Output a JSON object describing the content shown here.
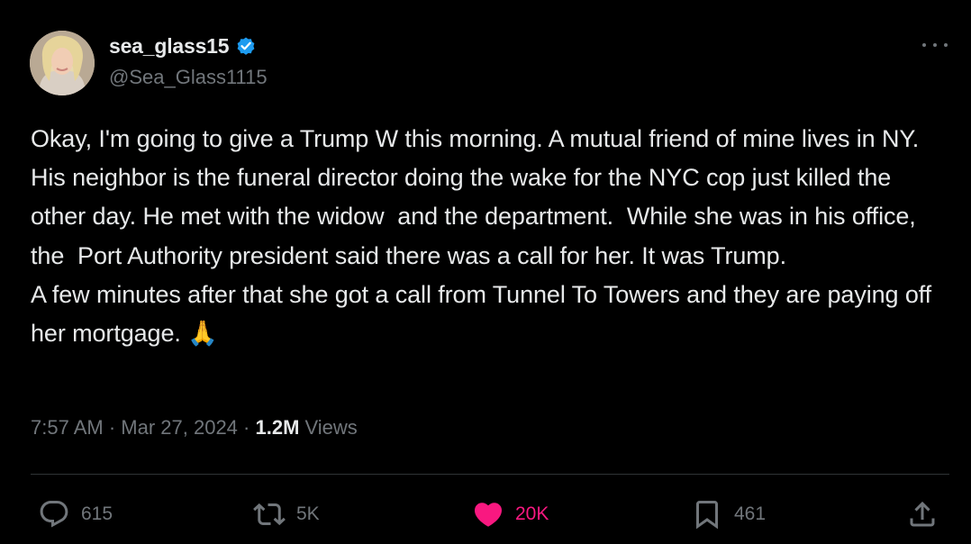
{
  "author": {
    "display_name": "sea_glass15",
    "handle": "@Sea_Glass1115",
    "verified_icon": "verified-badge-icon",
    "verified_color": "#1d9bf0"
  },
  "tweet": {
    "text": "Okay, I'm going to give a Trump W this morning. A mutual friend of mine lives in NY. His neighbor is the funeral director doing the wake for the NYC cop just killed the other day. He met with the widow  and the department.  While she was in his office, the  Port Authority president said there was a call for her. It was Trump.\nA few minutes after that she got a call from Tunnel To Towers and they are paying off her mortgage. 🙏",
    "time": "7:57 AM",
    "separator": " · ",
    "date": "Mar 27, 2024",
    "views_count": "1.2M",
    "views_label": " Views"
  },
  "actions": {
    "reply": {
      "icon": "reply-icon",
      "count": "615"
    },
    "retweet": {
      "icon": "retweet-icon",
      "count": "5K"
    },
    "like": {
      "icon": "heart-icon",
      "count": "20K",
      "active_color": "#f91880"
    },
    "bookmark": {
      "icon": "bookmark-icon",
      "count": "461"
    },
    "share": {
      "icon": "share-icon"
    }
  },
  "colors": {
    "background": "#000000",
    "primary_text": "#e7e9ea",
    "secondary_text": "#71767b",
    "divider": "#2f3336"
  }
}
